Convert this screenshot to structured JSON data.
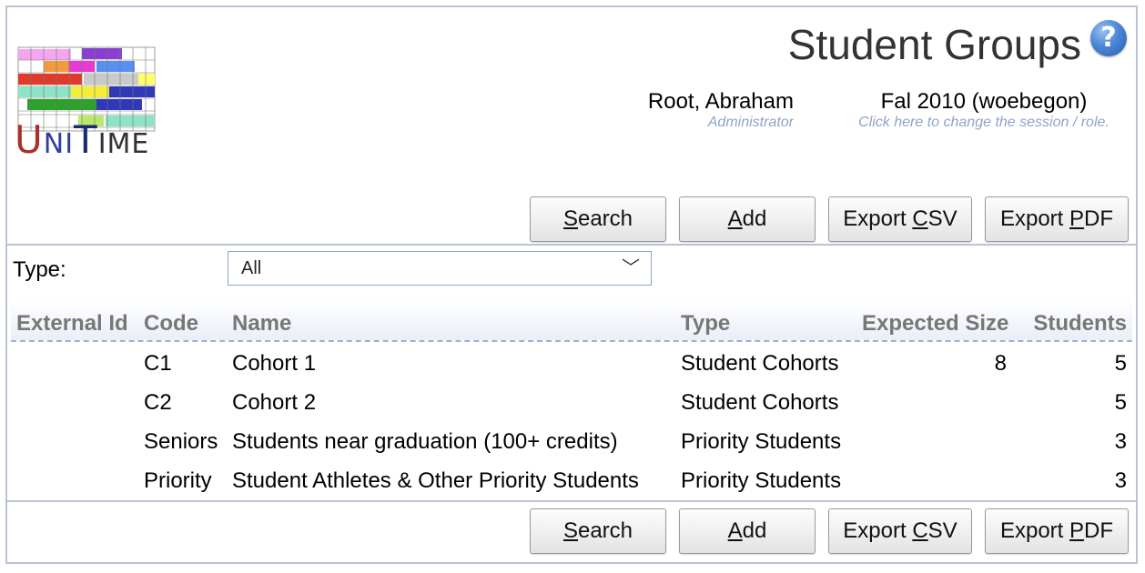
{
  "app": {
    "logo_text_parts": [
      "U",
      "NI",
      "T",
      "IME"
    ],
    "logo_colors": [
      "#a8312b",
      "#2b3fa0",
      "#1e2a6e",
      "#333333"
    ]
  },
  "header": {
    "title": "Student Groups",
    "help_symbol": "?",
    "user_name": "Root, Abraham",
    "user_role": "Administrator",
    "session_name": "Fal 2010 (woebegon)",
    "session_hint": "Click here to change the session / role."
  },
  "toolbar": {
    "search": {
      "pre": "",
      "key": "S",
      "post": "earch"
    },
    "add": {
      "pre": "",
      "key": "A",
      "post": "dd"
    },
    "export_csv": {
      "pre": "Export ",
      "key": "C",
      "post": "SV"
    },
    "export_pdf": {
      "pre": "Export ",
      "key": "P",
      "post": "DF"
    }
  },
  "filter": {
    "label": "Type:",
    "selected": "All",
    "chevron": "﹀"
  },
  "table": {
    "columns": {
      "external_id": "External Id",
      "code": "Code",
      "name": "Name",
      "type": "Type",
      "expected_size": "Expected Size",
      "students": "Students"
    },
    "rows": [
      {
        "external_id": "",
        "code": "C1",
        "name": "Cohort 1",
        "type": "Student Cohorts",
        "expected_size": "8",
        "students": "5"
      },
      {
        "external_id": "",
        "code": "C2",
        "name": "Cohort 2",
        "type": "Student Cohorts",
        "expected_size": "",
        "students": "5"
      },
      {
        "external_id": "",
        "code": "Seniors",
        "name": "Students near graduation (100+ credits)",
        "type": "Priority Students",
        "expected_size": "",
        "students": "3"
      },
      {
        "external_id": "",
        "code": "Priority",
        "name": "Student Athletes & Other Priority Students",
        "type": "Priority Students",
        "expected_size": "",
        "students": "3"
      }
    ]
  }
}
